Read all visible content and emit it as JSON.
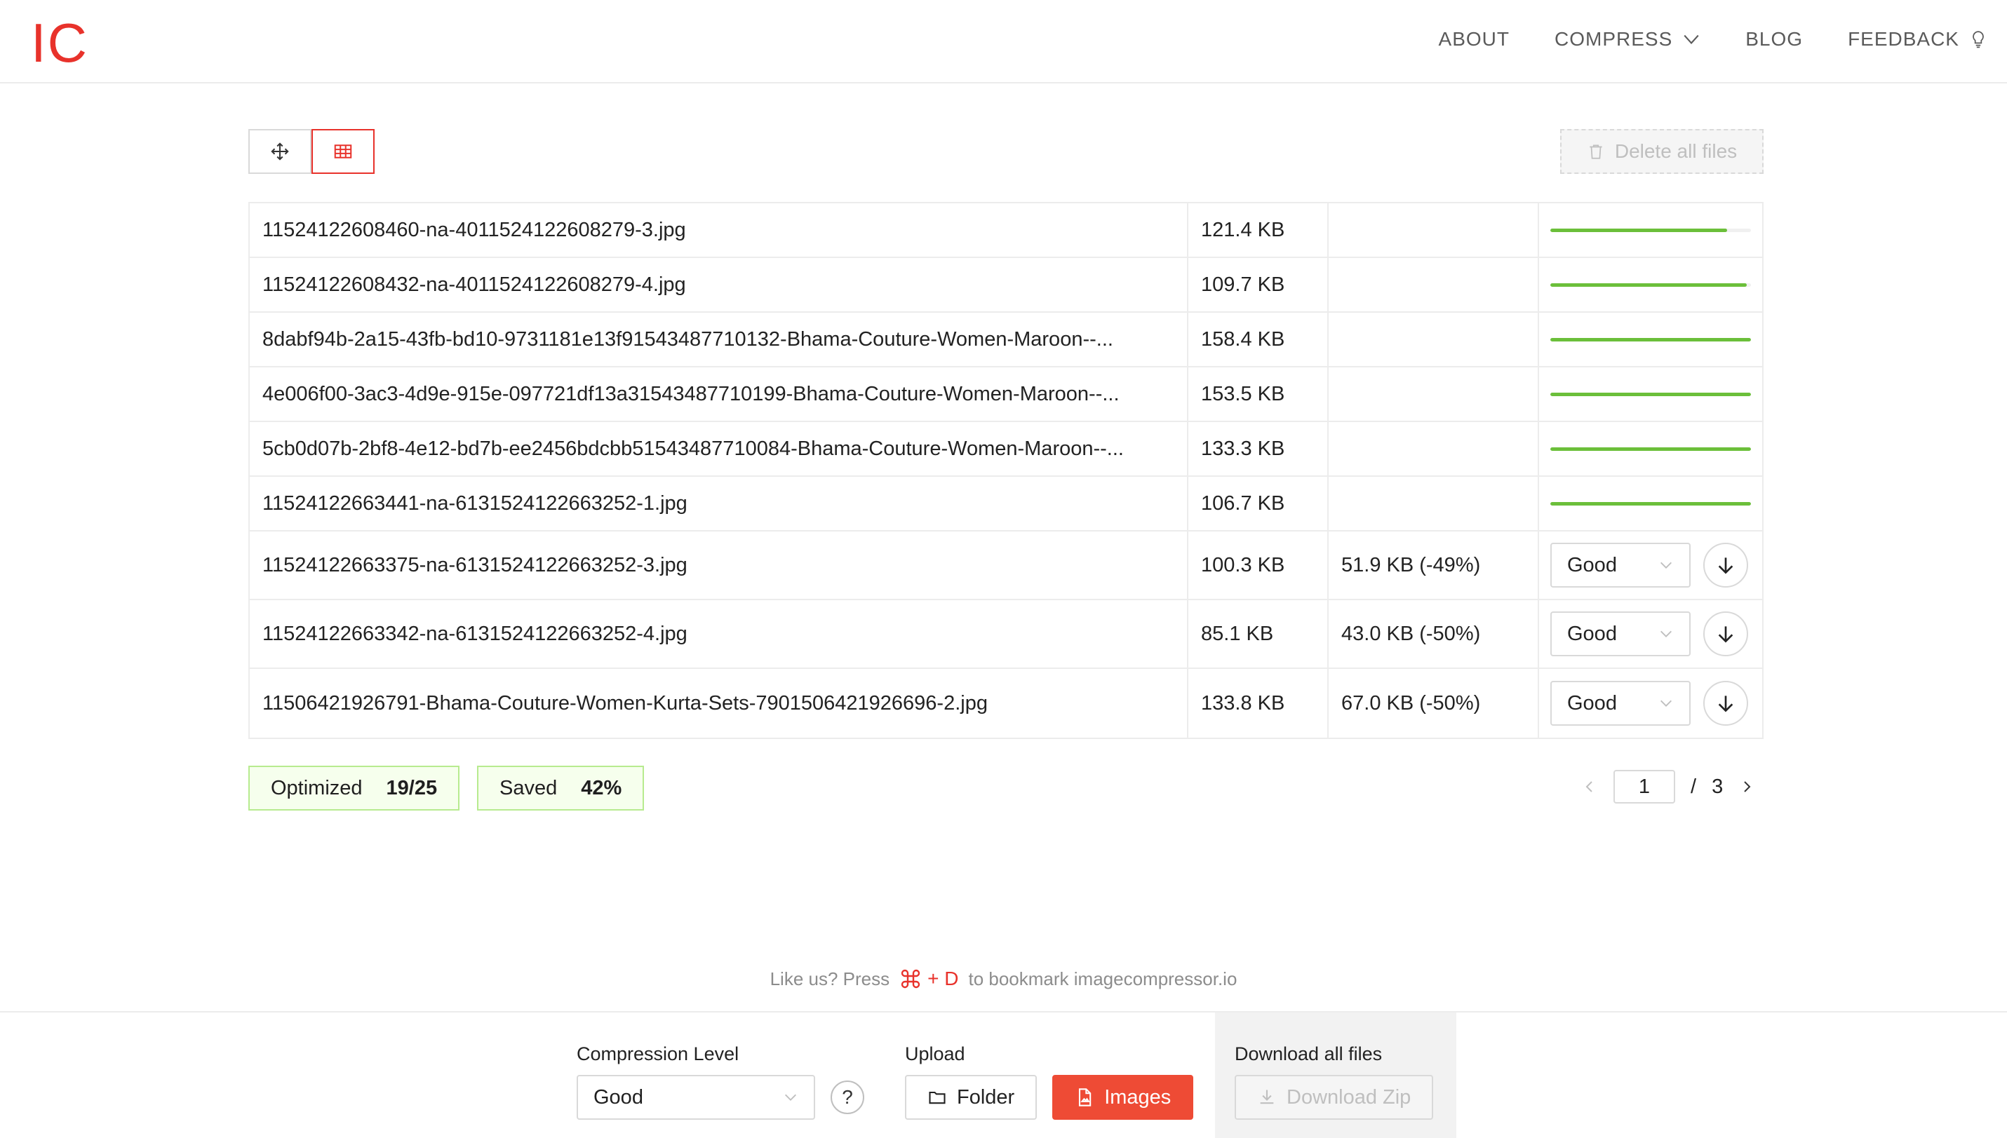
{
  "header": {
    "logo": "IC",
    "nav": [
      {
        "label": "ABOUT",
        "icon": ""
      },
      {
        "label": "COMPRESS",
        "icon": "chevron-down-icon"
      },
      {
        "label": "BLOG",
        "icon": ""
      },
      {
        "label": "FEEDBACK",
        "icon": "lightbulb-icon"
      }
    ]
  },
  "toolbar": {
    "view_modes": [
      "move-icon",
      "grid-icon"
    ],
    "active_view": "grid-icon",
    "delete_all_label": "Delete all files"
  },
  "files": [
    {
      "name": "11524122608460-na-4011524122608279-3.jpg",
      "size": "121.4 KB",
      "progress": 0.88
    },
    {
      "name": "11524122608432-na-4011524122608279-4.jpg",
      "size": "109.7 KB",
      "progress": 0.98
    },
    {
      "name": "8dabf94b-2a15-43fb-bd10-9731181e13f91543487710132-Bhama-Couture-Women-Maroon--...",
      "size": "158.4 KB",
      "progress": 1.0
    },
    {
      "name": "4e006f00-3ac3-4d9e-915e-097721df13a31543487710199-Bhama-Couture-Women-Maroon--...",
      "size": "153.5 KB",
      "progress": 1.0
    },
    {
      "name": "5cb0d07b-2bf8-4e12-bd7b-ee2456bdcbb51543487710084-Bhama-Couture-Women-Maroon--...",
      "size": "133.3 KB",
      "progress": 1.0
    },
    {
      "name": "11524122663441-na-6131524122663252-1.jpg",
      "size": "106.7 KB",
      "progress": 1.0
    },
    {
      "name": "11524122663375-na-6131524122663252-3.jpg",
      "size": "100.3 KB",
      "compressed": "51.9 KB (-49%)",
      "level": "Good"
    },
    {
      "name": "11524122663342-na-6131524122663252-4.jpg",
      "size": "85.1 KB",
      "compressed": "43.0 KB (-50%)",
      "level": "Good"
    },
    {
      "name": "11506421926791-Bhama-Couture-Women-Kurta-Sets-7901506421926696-2.jpg",
      "size": "133.8 KB",
      "compressed": "67.0 KB (-50%)",
      "level": "Good"
    }
  ],
  "stats": {
    "optimized_label": "Optimized",
    "optimized_value": "19/25",
    "saved_label": "Saved",
    "saved_value": "42%"
  },
  "pagination": {
    "current": "1",
    "separator": "/",
    "total": "3"
  },
  "hint": {
    "prefix": "Like us? Press",
    "key": "+ D",
    "suffix": "to bookmark imagecompressor.io"
  },
  "footer": {
    "compression_label": "Compression Level",
    "compression_value": "Good",
    "help": "?",
    "upload_label": "Upload",
    "folder_label": "Folder",
    "images_label": "Images",
    "download_label": "Download all files",
    "download_zip_label": "Download Zip"
  },
  "colors": {
    "brand": "#e8322b",
    "primary_button": "#ee4b35",
    "progress": "#6bbf3a",
    "stat_border": "#b7eb8f",
    "stat_bg": "#f6ffed"
  }
}
